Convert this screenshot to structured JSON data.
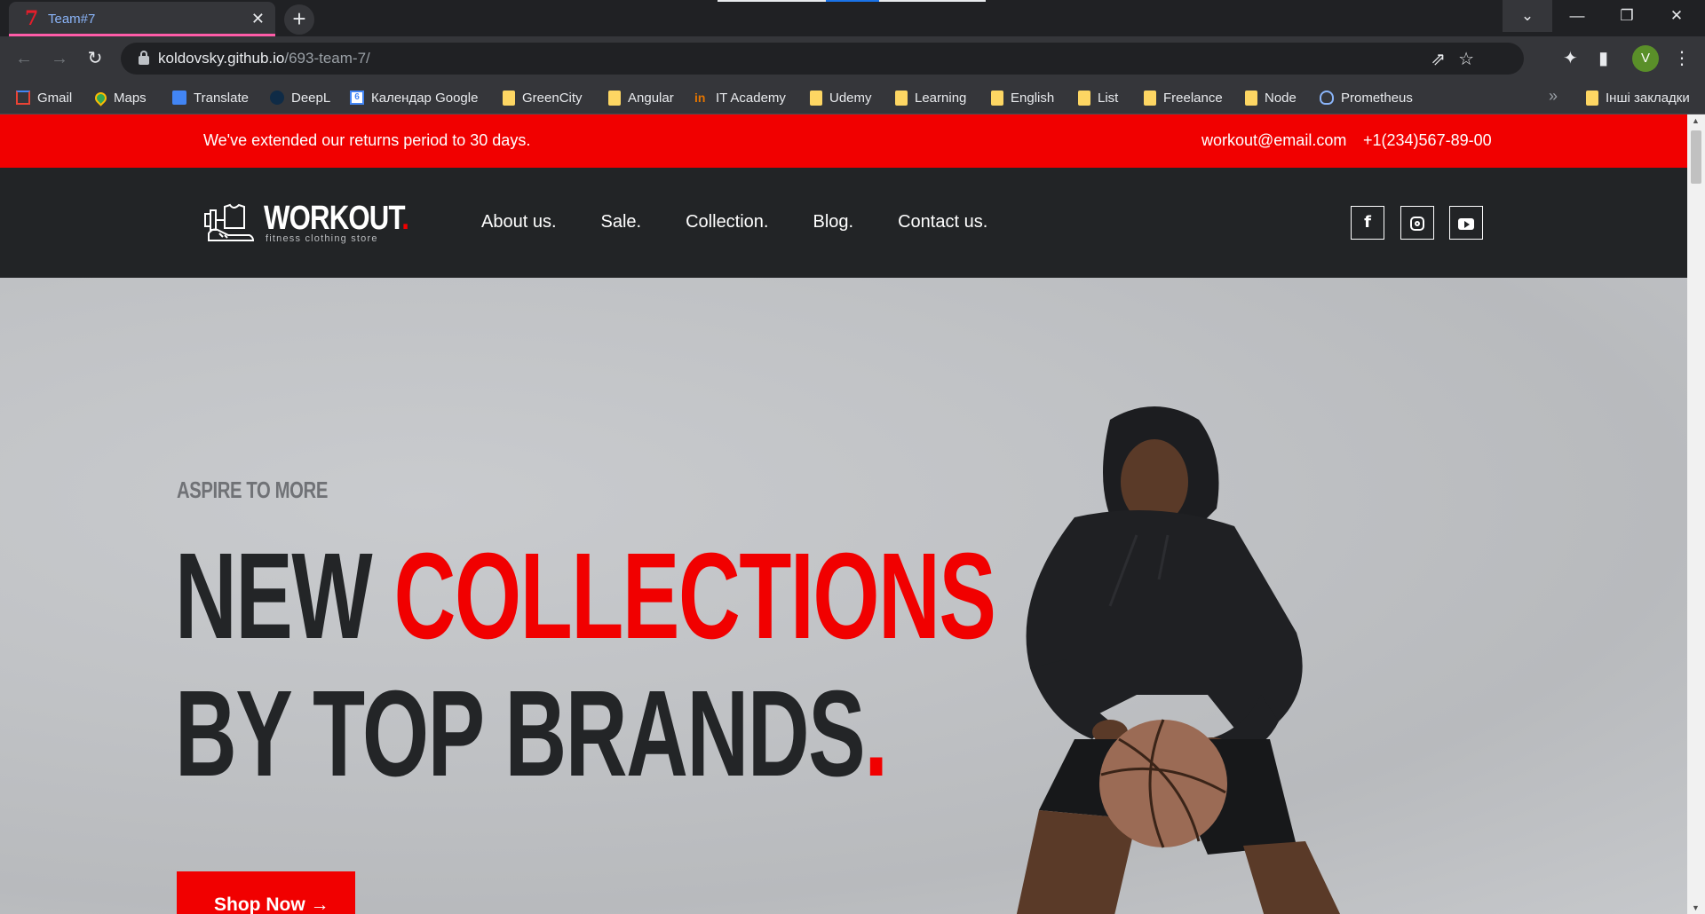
{
  "browser": {
    "tab": {
      "favicon": "7",
      "title": "Team#7",
      "close": "✕"
    },
    "new_tab": "+",
    "window_buttons": {
      "tabsearch": "⌄",
      "minimize": "—",
      "restore": "❐",
      "close": "✕"
    },
    "nav": {
      "back": "←",
      "forward": "→",
      "reload": "↻"
    },
    "url": {
      "host": "koldovsky.github.io",
      "path": "/693-team-7/"
    },
    "omnibox_icons": {
      "share": "⇗",
      "star": "☆"
    },
    "toolbar_icons": {
      "puzzle": "✦",
      "sidepanel": "▮",
      "menu": "⋮"
    },
    "avatar": "V",
    "bookmarks": [
      {
        "label": "Gmail",
        "icon": "gmail-icon"
      },
      {
        "label": "Maps",
        "icon": "maps-icon"
      },
      {
        "label": "Translate",
        "icon": "translate-icon"
      },
      {
        "label": "DeepL",
        "icon": "deepl-icon"
      },
      {
        "label": "Календар Google",
        "icon": "calendar-icon"
      },
      {
        "label": "GreenCity",
        "icon": "folder-icon"
      },
      {
        "label": "Angular",
        "icon": "folder-icon"
      },
      {
        "label": "IT Academy",
        "icon": "itacademy-icon"
      },
      {
        "label": "Udemy",
        "icon": "folder-icon"
      },
      {
        "label": "Learning",
        "icon": "folder-icon"
      },
      {
        "label": "English",
        "icon": "folder-icon"
      },
      {
        "label": "List",
        "icon": "folder-icon"
      },
      {
        "label": "Freelance",
        "icon": "folder-icon"
      },
      {
        "label": "Node",
        "icon": "folder-icon"
      },
      {
        "label": "Prometheus",
        "icon": "prometheus-icon"
      }
    ],
    "bookmarks_more": "»",
    "other_bookmarks": "Інші закладки"
  },
  "page": {
    "announcement": {
      "message": "We've extended our returns period to 30 days.",
      "email": "workout@email.com",
      "phone": "+1(234)567-89-00"
    },
    "logo": {
      "word": "WORKOUT",
      "dot": ".",
      "tagline": "fitness clothing store"
    },
    "nav": [
      "About us.",
      "Sale.",
      "Collection.",
      "Blog.",
      "Contact us."
    ],
    "social": {
      "facebook": "f"
    },
    "hero": {
      "eyebrow": "ASPIRE TO MORE",
      "line1_dark": "NEW ",
      "line1_red": "COLLECTIONS",
      "line2_dark": "BY TOP BRANDS",
      "line2_red": ".",
      "button": "Shop Now →"
    }
  },
  "colors": {
    "accent": "#f10000",
    "header_bg": "#222426",
    "hero_text": "#232527"
  }
}
